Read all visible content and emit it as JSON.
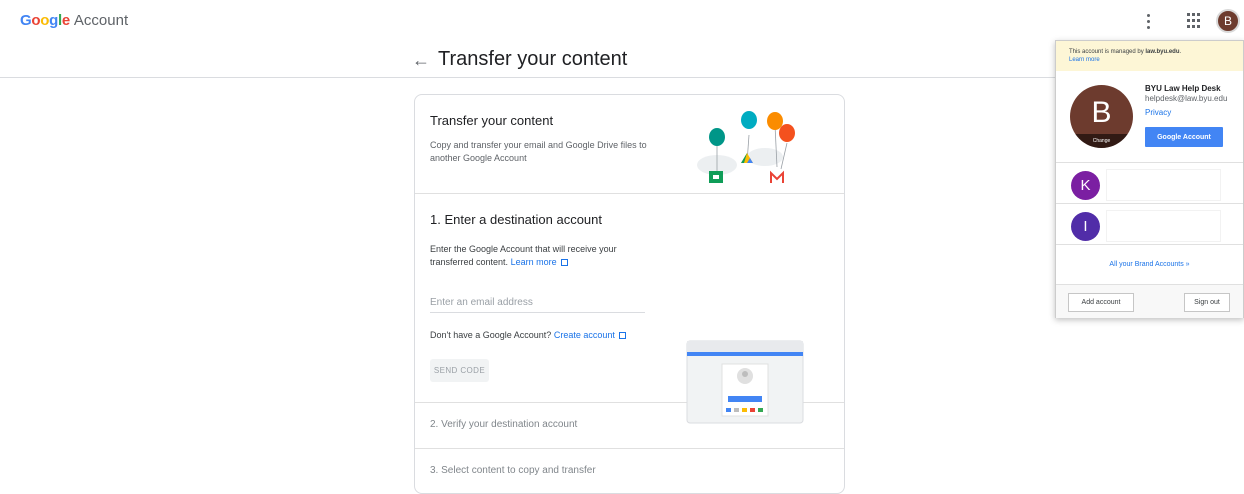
{
  "topbar": {
    "logo_google": "Google",
    "logo_account": "Account",
    "avatar_initial": "B"
  },
  "header": {
    "back_arrow": "←",
    "title": "Transfer your content"
  },
  "card": {
    "intro": {
      "title": "Transfer your content",
      "description": "Copy and transfer your email and Google Drive files to another Google Account"
    },
    "step1": {
      "title": "1. Enter a destination account",
      "description": "Enter the Google Account that will receive your transferred content.",
      "learn_more": "Learn more",
      "email_placeholder": "Enter an email address",
      "no_account_text": "Don't have a Google Account?",
      "create_account": "Create account",
      "send_code": "SEND CODE"
    },
    "step2": {
      "title": "2. Verify your destination account"
    },
    "step3": {
      "title": "3. Select content to copy and transfer"
    }
  },
  "account_popover": {
    "managed_prefix": "This account is managed by",
    "managed_domain": "law.byu.edu",
    "managed_suffix": ".",
    "learn_more": "Learn more",
    "avatar_initial": "B",
    "change": "Change",
    "name": "BYU Law Help Desk",
    "email": "helpdesk@law.byu.edu",
    "privacy": "Privacy",
    "google_account_button": "Google Account",
    "other_accounts": [
      {
        "initial": "K",
        "color": "#7b1fa2"
      },
      {
        "initial": "I",
        "color": "#512da8"
      }
    ],
    "brand_accounts": "All your Brand Accounts »",
    "add_account": "Add account",
    "sign_out": "Sign out"
  },
  "colors": {
    "link": "#1a73e8",
    "primary_button": "#4285f4",
    "avatar": "#6d3b2e"
  }
}
